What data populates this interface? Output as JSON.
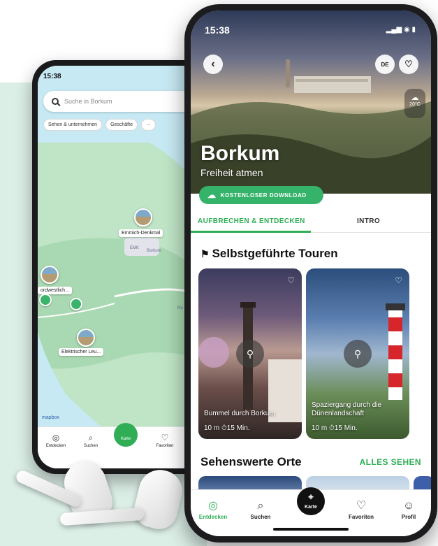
{
  "back_phone": {
    "status_time": "15:38",
    "search_placeholder": "Suche in Borkum",
    "chips": [
      "Sehen & unternehmen",
      "Geschäfte",
      "···"
    ],
    "pins": [
      "Emmich-Denkmal",
      "ordwestlich...",
      "Elektrischer Leu..."
    ],
    "town": "Borkum",
    "airport": "EMK",
    "road_label": "Ru",
    "attribution": "mapbox",
    "nav": [
      "Entdecken",
      "Suchen",
      "Karte",
      "Favoriten"
    ]
  },
  "front_phone": {
    "status_time": "15:38",
    "lang_badge": "DE",
    "weather_temp": "20°C",
    "hero_title": "Borkum",
    "hero_subtitle": "Freiheit atmen",
    "download_label": "KOSTENLOSER DOWNLOAD",
    "tabs": [
      "AUFBRECHEN & ENTDECKEN",
      "INTRO"
    ],
    "section1_title": "Selbstgeführte Touren",
    "tours": [
      {
        "title": "Bummel durch Borkum",
        "meta": "10 m  ⏱15 Min."
      },
      {
        "title": "Spaziergang durch die Dünenlandschaft",
        "meta": "10 m  ⏱15 Min."
      }
    ],
    "section2_title": "Sehenswerte Orte",
    "see_all": "ALLES SEHEN",
    "nav": [
      "Entdecken",
      "Suchen",
      "Karte",
      "Favoriten",
      "Profil"
    ]
  },
  "colors": {
    "accent": "#2fae55",
    "mint_bg": "#dcefe7"
  },
  "icons": [
    "back-icon",
    "heart-icon",
    "cloud-icon",
    "route-icon",
    "compass-icon",
    "search-icon",
    "map-pin-icon",
    "user-icon"
  ]
}
